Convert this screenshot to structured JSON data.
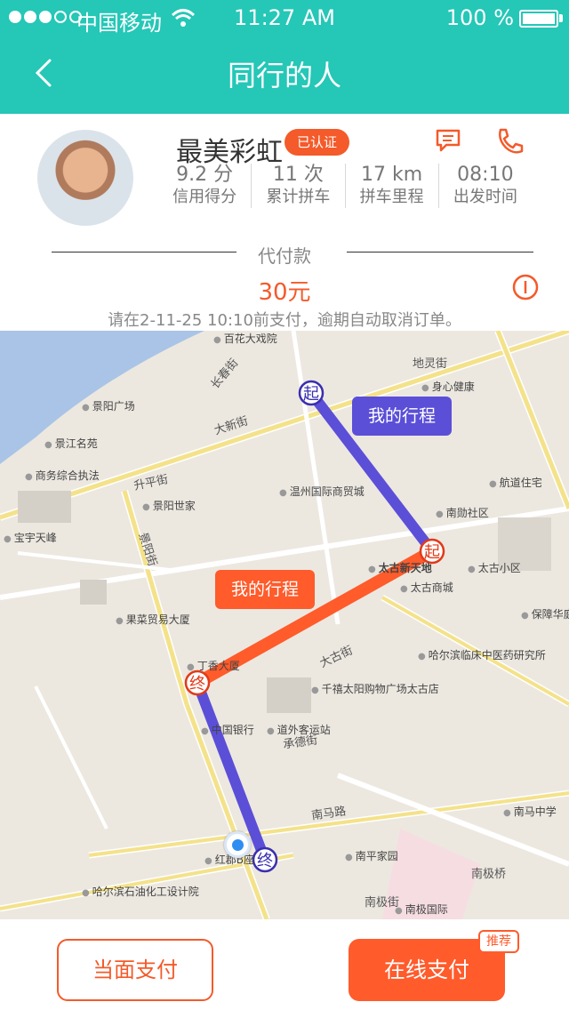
{
  "status_bar": {
    "carrier": "中国移动",
    "time": "11:27 AM",
    "battery_percent": "100 %"
  },
  "nav": {
    "title": "同行的人",
    "back_icon": "chevron-left-icon"
  },
  "profile": {
    "name": "最美彩虹",
    "badge": "已认证",
    "chat_icon": "chat-bubble-icon",
    "phone_icon": "phone-icon",
    "stats": [
      {
        "value": "9.2 分",
        "label": "信用得分"
      },
      {
        "value": "11  次",
        "label": "累计拼车"
      },
      {
        "value": "17 km",
        "label": "拼车里程"
      },
      {
        "value": "08:10",
        "label": "出发时间"
      }
    ]
  },
  "payment": {
    "label": "代付款",
    "amount": "30元",
    "deadline": "请在2-11-25  10:10前支付，逾期自动取消订单。",
    "info_icon": "info-icon"
  },
  "map": {
    "route_markers": {
      "start": "起",
      "end": "终"
    },
    "bubbles": {
      "blue": "我的行程",
      "orange": "我的行程"
    },
    "streets": [
      "大新街",
      "长春街",
      "升平街",
      "景阳街",
      "承德街",
      "南马路",
      "南极街",
      "大古街"
    ],
    "pois": [
      "百花大戏院",
      "景阳广场",
      "景江名苑",
      "商务综合执法",
      "宝宇天峰",
      "景阳世家",
      "温州国际商贸城",
      "太古商城",
      "太古新天地",
      "哈尔滨临床中医药研究所",
      "千禧太阳购物广场太古店",
      "中国银行",
      "红郡B座",
      "哈尔滨石油化工设计院",
      "南平家园",
      "南极国际",
      "南马中学",
      "身心健康",
      "航道住宅",
      "南勋社区",
      "太古小区",
      "保障华庭",
      "果菜贸易大厦",
      "丁香大厦",
      "道外客运站",
      "南极桥",
      "地灵街"
    ],
    "route_colors": {
      "blue": "#5b4fd8",
      "orange": "#ff5b2b"
    }
  },
  "actions": {
    "pay_face": "当面支付",
    "pay_online": "在线支付",
    "recommend": "推荐"
  },
  "colors": {
    "teal": "#25c7b7",
    "accent": "#f45a2a"
  }
}
